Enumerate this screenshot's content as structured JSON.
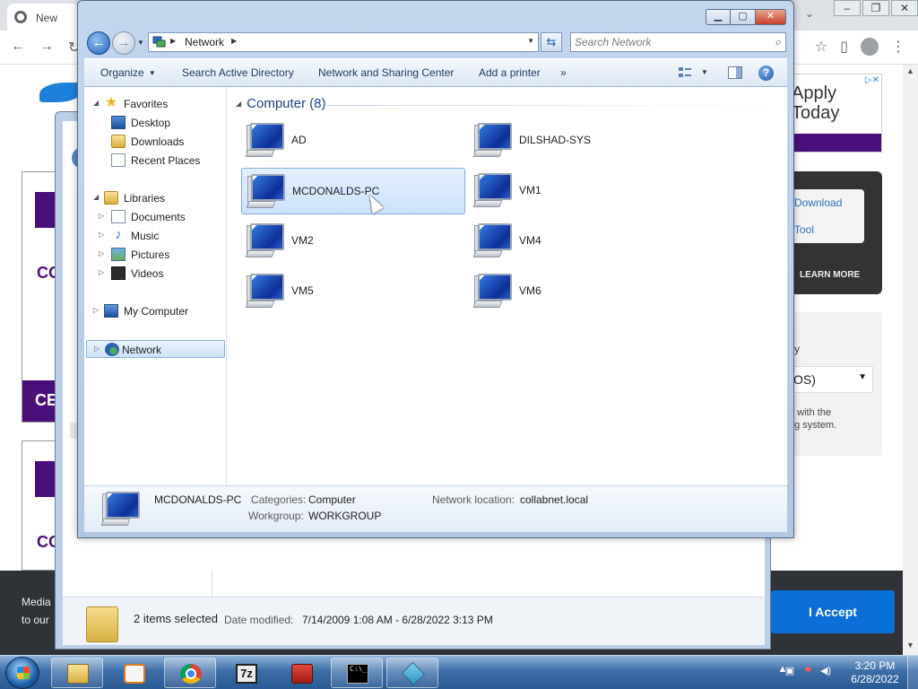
{
  "browser": {
    "tab_title": "New",
    "ad": {
      "line1": "Apply",
      "line2": "Today"
    },
    "side_links": [
      "Download",
      "Tool"
    ],
    "learn_more": "LEARN MORE",
    "grey_text1": "ity",
    "select_value": "OS)",
    "grey_text2": "e with the",
    "grey_text3": "ng system.",
    "left_co_1": "CO",
    "left_band_1": "CE",
    "left_co_2": "CO",
    "cookie_line1": "Media",
    "cookie_line2": "to our",
    "accept_label": "I Accept"
  },
  "back_window": {
    "selection_count": "2 items selected",
    "date_modified_label": "Date modified:",
    "date_modified_value": "7/14/2009 1:08 AM - 6/28/2022 3:13 PM"
  },
  "window": {
    "address": {
      "location": "Network"
    },
    "search": {
      "placeholder": "Search Network"
    },
    "commands": {
      "organize": "Organize",
      "search_ad": "Search Active Directory",
      "network_sharing": "Network and Sharing Center",
      "add_printer": "Add a printer",
      "more": "»"
    },
    "nav": {
      "favorites": "Favorites",
      "desktop": "Desktop",
      "downloads": "Downloads",
      "recent_places": "Recent Places",
      "libraries": "Libraries",
      "documents": "Documents",
      "music": "Music",
      "pictures": "Pictures",
      "videos": "Videos",
      "my_computer": "My Computer",
      "network": "Network"
    },
    "group_header": "Computer (8)",
    "computers": [
      "AD",
      "DILSHAD-SYS",
      "MCDONALDS-PC",
      "VM1",
      "VM2",
      "VM4",
      "VM5",
      "VM6"
    ],
    "selected_computer": "MCDONALDS-PC",
    "details": {
      "name": "MCDONALDS-PC",
      "categories_label": "Categories:",
      "categories_value": "Computer",
      "workgroup_label": "Workgroup:",
      "workgroup_value": "WORKGROUP",
      "location_label": "Network location:",
      "location_value": "collabnet.local"
    }
  },
  "taskbar": {
    "clock_time": "3:20 PM",
    "clock_date": "6/28/2022",
    "apps": [
      "windows-explorer",
      "media-player",
      "chrome",
      "7-zip",
      "toolbox",
      "command-prompt",
      "cubes-app"
    ]
  }
}
